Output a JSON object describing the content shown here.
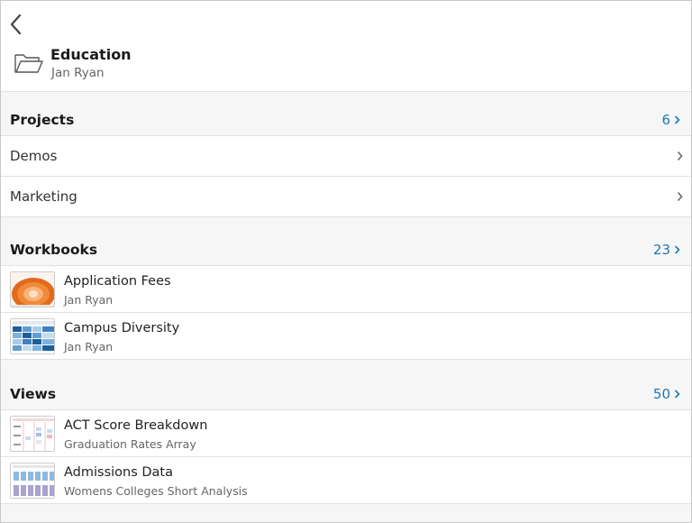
{
  "header": {
    "title": "Education",
    "owner": "Jan Ryan"
  },
  "projects": {
    "title": "Projects",
    "count": "6",
    "items": [
      {
        "label": "Demos"
      },
      {
        "label": "Marketing"
      }
    ]
  },
  "workbooks": {
    "title": "Workbooks",
    "count": "23",
    "items": [
      {
        "name": "Application Fees",
        "sub": "Jan Ryan"
      },
      {
        "name": "Campus Diversity",
        "sub": "Jan Ryan"
      }
    ]
  },
  "views": {
    "title": "Views",
    "count": "50",
    "items": [
      {
        "name": "ACT Score Breakdown",
        "sub": "Graduation Rates Array"
      },
      {
        "name": "Admissions Data",
        "sub": "Womens Colleges Short Analysis"
      }
    ]
  },
  "colors": {
    "accent": "#1f77b4",
    "background": "#f6f6f6"
  },
  "icons": [
    "back-chevron-icon",
    "folder-icon",
    "chevron-right-icon"
  ]
}
